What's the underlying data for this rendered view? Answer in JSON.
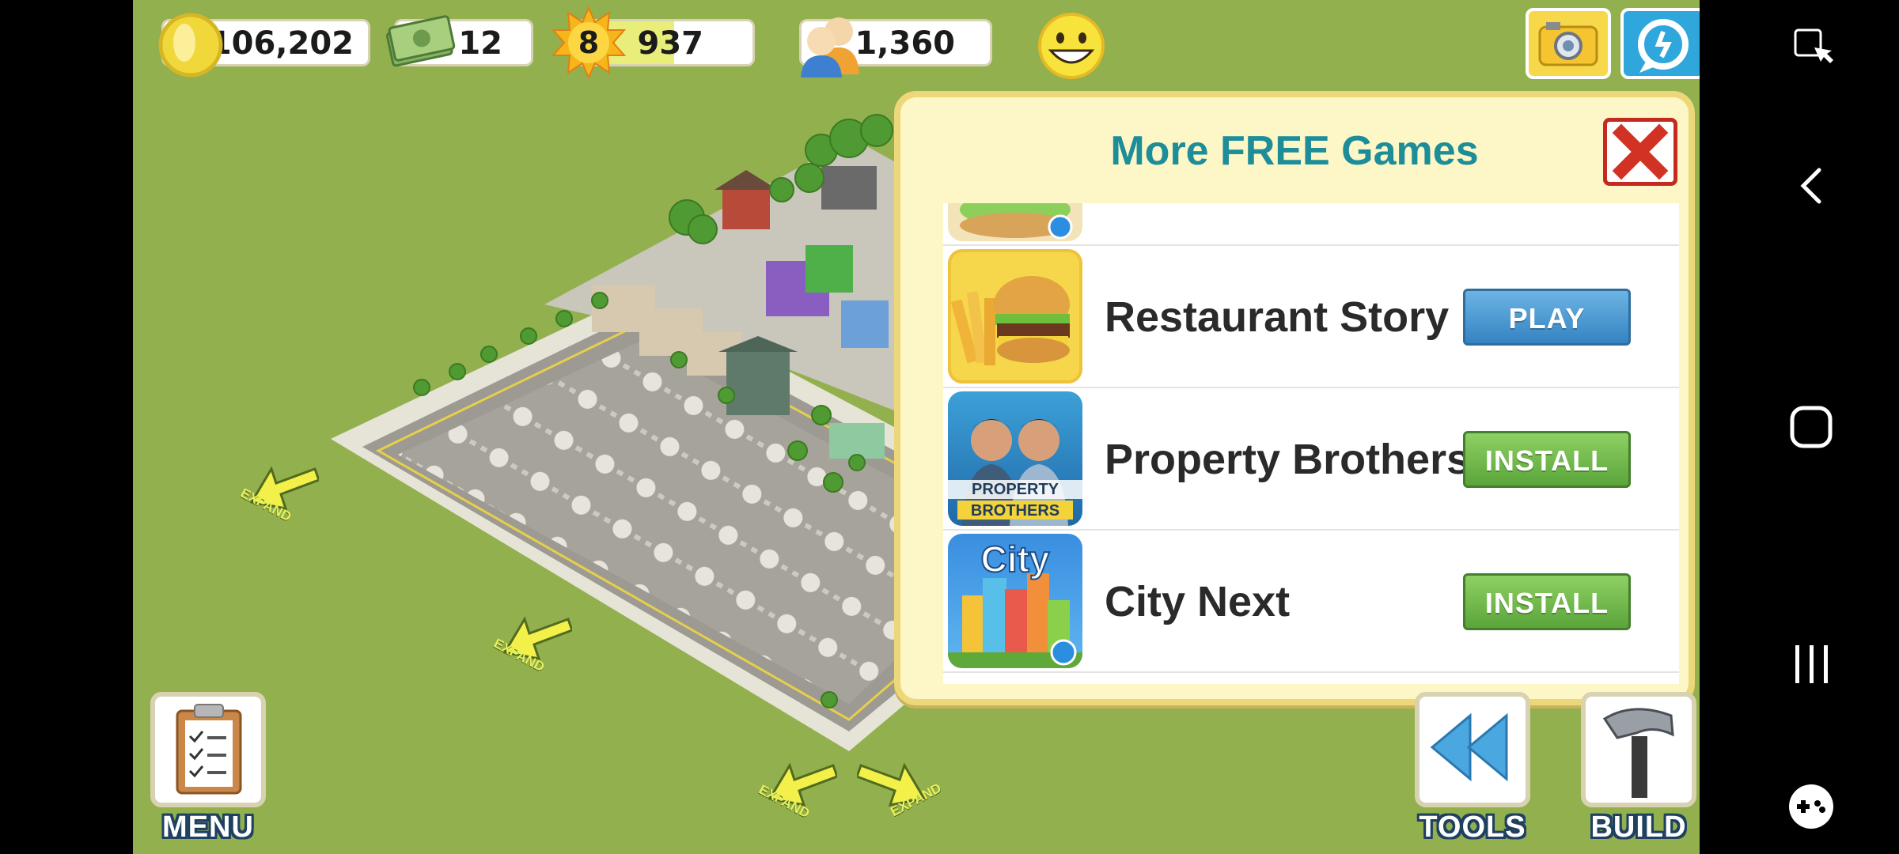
{
  "hud": {
    "coins": "106,202",
    "cash": "12",
    "level": "8",
    "xp": "937",
    "xp_progress": 0.55,
    "population": "1,360"
  },
  "modal": {
    "title": "More FREE Games",
    "games": [
      {
        "name": "Restaurant Story",
        "button": "PLAY",
        "icon": "burger-fries-icon"
      },
      {
        "name": "Property Brothers",
        "button": "INSTALL",
        "icon": "property-brothers-icon"
      },
      {
        "name": "City Next",
        "button": "INSTALL",
        "icon": "city-skyline-icon"
      }
    ]
  },
  "bottom": {
    "menu_label": "MENU",
    "tools_label": "TOOLS",
    "build_label": "BUILD"
  },
  "expand_label": "EXPAND",
  "colors": {
    "grass": "#93b04f",
    "modal_title": "#1c8d99",
    "play_button": "#3583c2",
    "install_button": "#5aa53a",
    "close_red": "#c32a20"
  }
}
